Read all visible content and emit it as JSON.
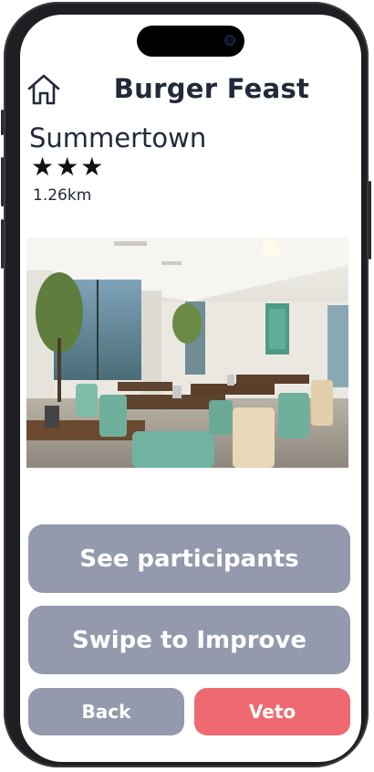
{
  "header": {
    "title": "Burger Feast",
    "home_icon": "home-icon"
  },
  "restaurant": {
    "location": "Summertown",
    "rating": 3,
    "stars_display": "★★★",
    "distance": "1.26km",
    "photo_alt": "Restaurant interior"
  },
  "actions": {
    "participants_label": "See participants",
    "improve_label": "Swipe to Improve",
    "back_label": "Back",
    "veto_label": "Veto"
  },
  "colors": {
    "button_grey": "#9499ad",
    "button_red": "#ee6a70",
    "text_dark": "#222a3a"
  }
}
